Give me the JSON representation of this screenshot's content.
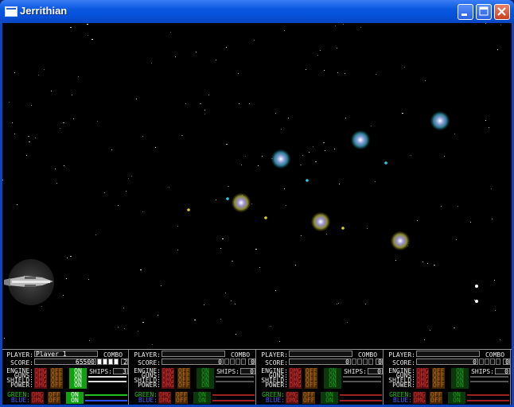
{
  "window": {
    "title": "Jerrithian"
  },
  "colors": {
    "titlebar": "#0a58e0",
    "space": "#000000",
    "hud_border": "#888888"
  },
  "icons": [
    "window-app-icon",
    "minimize-icon",
    "maximize-icon",
    "close-icon"
  ],
  "hud": {
    "labels": {
      "player": "PLAYER:",
      "score": "SCORE:",
      "combo": "COMBO",
      "ships": "SHIPS:",
      "engine": "ENGINE:",
      "guns": "GUNS:",
      "shield": "SHIELD:",
      "power": "POWER:",
      "green": "GREEN:",
      "blue": "BLUE:",
      "dmg": "DMG",
      "off": "OFF",
      "on": "ON"
    },
    "players": [
      {
        "name": "Player 1",
        "score": "65500",
        "combo": "2",
        "ships": "3",
        "active": true
      },
      {
        "name": "",
        "score": "0",
        "combo": "0",
        "ships": "0",
        "active": false
      },
      {
        "name": "",
        "score": "0",
        "combo": "0",
        "ships": "0",
        "active": false
      },
      {
        "name": "",
        "score": "0",
        "combo": "0",
        "ships": "0",
        "active": false
      }
    ]
  }
}
